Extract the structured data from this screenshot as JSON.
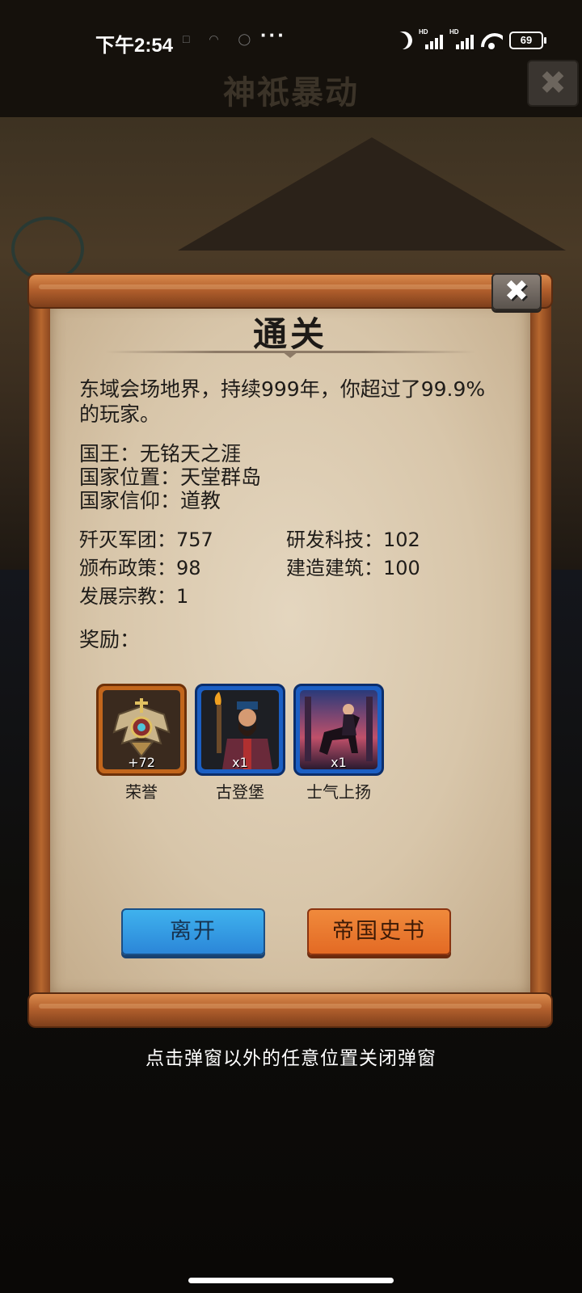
{
  "status_bar": {
    "time": "下午2:54",
    "more": "···",
    "battery": "69",
    "signal_badge": "HD"
  },
  "background": {
    "title": "神祇暴动",
    "close_glyph": "✖"
  },
  "dialog": {
    "close_glyph": "✖",
    "title": "通关",
    "summary": "东域会场地界，持续999年，你超过了99.9%的玩家。",
    "info": {
      "king": "国王：无铭天之涯",
      "location": "国家位置：天堂群岛",
      "faith": "国家信仰：道教"
    },
    "stats": {
      "legions_destroyed": "歼灭军团：757",
      "tech_researched": "研发科技：102",
      "policies_issued": "颁布政策：98",
      "buildings_built": "建造建筑：100",
      "religions_developed": "发展宗教：1"
    },
    "rewards_label": "奖励：",
    "rewards": [
      {
        "label": "荣誉",
        "count": "+72",
        "frame": "orange",
        "icon": "honor-emblem-icon"
      },
      {
        "label": "古登堡",
        "count": "x1",
        "frame": "blue",
        "icon": "gutenberg-portrait-icon"
      },
      {
        "label": "士气上扬",
        "count": "x1",
        "frame": "blue",
        "icon": "morale-knight-icon"
      }
    ],
    "buttons": {
      "leave": "离开",
      "history": "帝国史书"
    }
  },
  "hint": "点击弹窗以外的任意位置关闭弹窗"
}
